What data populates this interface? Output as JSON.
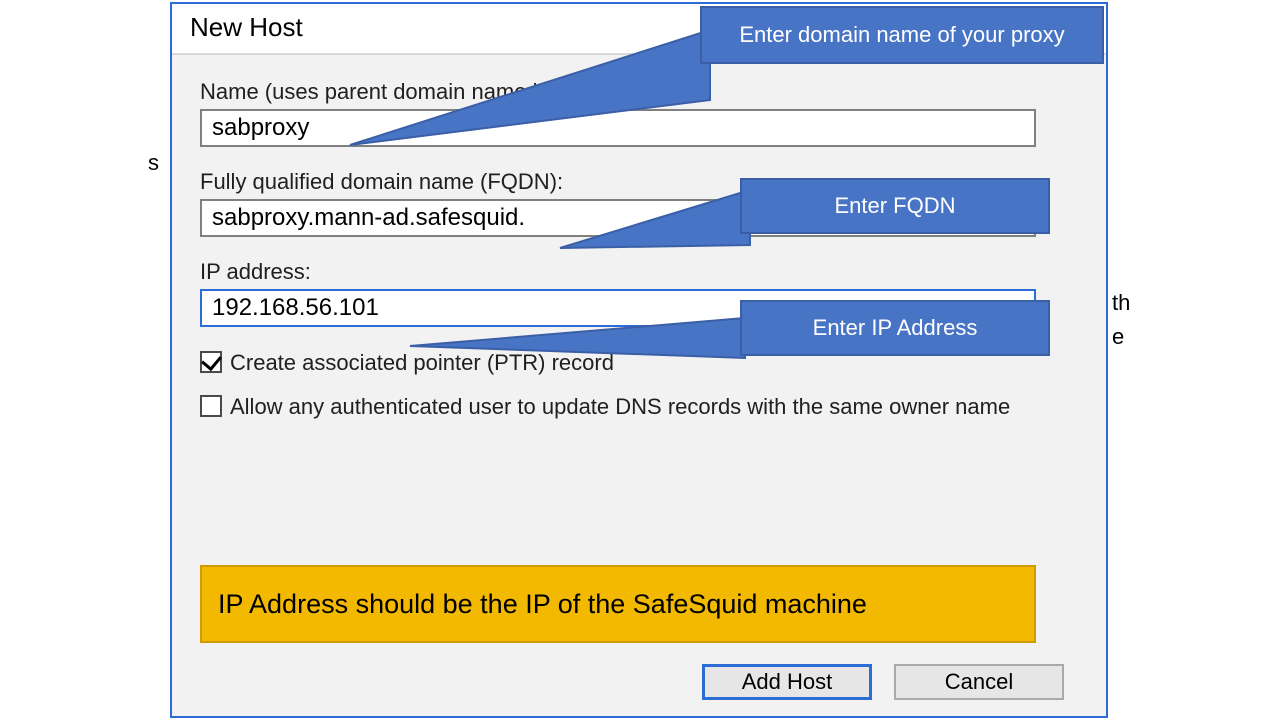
{
  "bg": {
    "left": "s",
    "right_top": "th",
    "right_bottom": "e"
  },
  "dialog": {
    "title": "New Host",
    "name_label": "Name (uses parent domain name if blank):",
    "name_value": "sabproxy",
    "fqdn_label": "Fully qualified domain name (FQDN):",
    "fqdn_value": "sabproxy.mann-ad.safesquid.",
    "ip_label": "IP address:",
    "ip_value": "192.168.56.101",
    "ptr_label": "Create associated pointer (PTR) record",
    "allow_update_label": "Allow any authenticated user to update DNS records with the same owner name",
    "note": "IP Address should be the IP of the SafeSquid machine",
    "add_host_btn": "Add Host",
    "cancel_btn": "Cancel"
  },
  "callouts": {
    "domain": "Enter domain name of your proxy",
    "fqdn": "Enter FQDN",
    "ip": "Enter IP Address"
  },
  "colors": {
    "accent": "#2b6cd6",
    "callout": "#4874c6",
    "note_bg": "#f2b900"
  }
}
